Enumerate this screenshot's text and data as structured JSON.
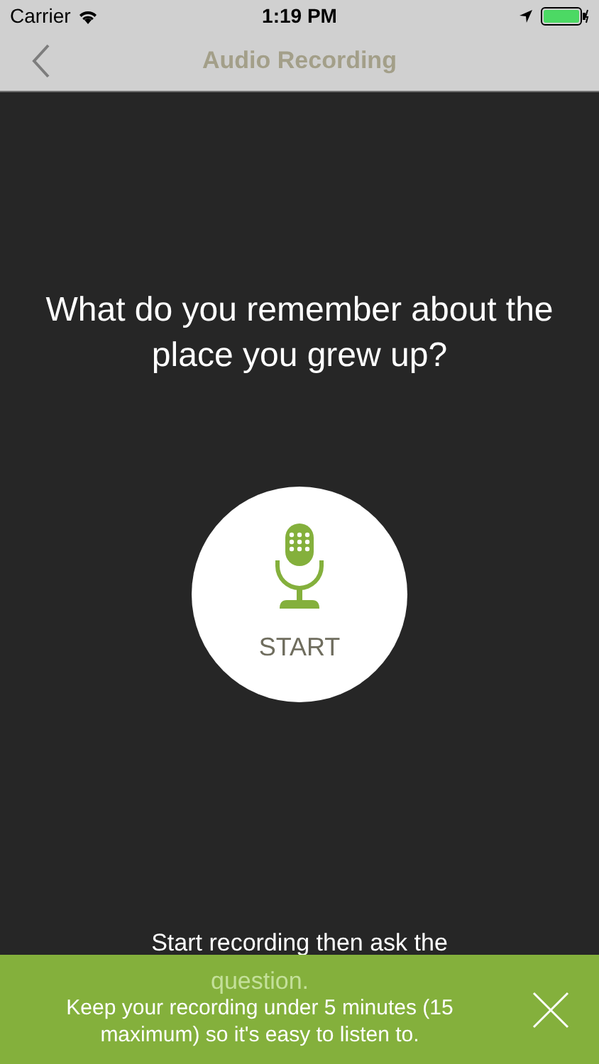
{
  "status_bar": {
    "carrier": "Carrier",
    "time": "1:19 PM"
  },
  "nav": {
    "title": "Audio Recording"
  },
  "prompt": "What do you remember about the place you grew up?",
  "record_button": {
    "label": "START"
  },
  "instruction_lines": [
    "Start recording then ask the",
    "question."
  ],
  "banner": {
    "message": "Keep your recording under 5 minutes (15 maximum) so it's easy to listen to."
  }
}
